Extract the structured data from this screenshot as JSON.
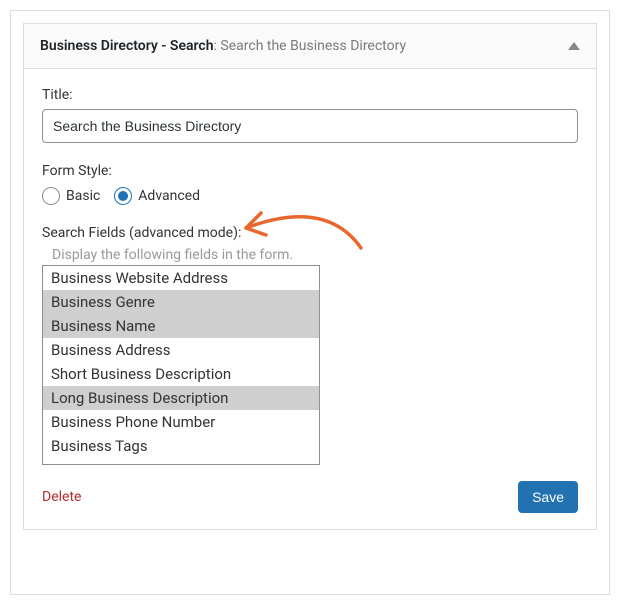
{
  "header": {
    "title_prefix": "Business Directory - Search",
    "title_suffix": ": Search the Business Directory"
  },
  "fields": {
    "title_label": "Title:",
    "title_value": "Search the Business Directory",
    "form_style_label": "Form Style:",
    "radio_basic": "Basic",
    "radio_advanced": "Advanced",
    "search_fields_label": "Search Fields (advanced mode):",
    "search_fields_helper": "Display the following fields in the form.",
    "options": [
      {
        "label": "Business Website Address",
        "selected": false
      },
      {
        "label": "Business Genre",
        "selected": true
      },
      {
        "label": "Business Name",
        "selected": true
      },
      {
        "label": "Business Address",
        "selected": false
      },
      {
        "label": "Short Business Description",
        "selected": false
      },
      {
        "label": "Long Business Description",
        "selected": true
      },
      {
        "label": "Business Phone Number",
        "selected": false
      },
      {
        "label": "Business Tags",
        "selected": false
      }
    ]
  },
  "footer": {
    "delete_label": "Delete",
    "save_label": "Save"
  },
  "colors": {
    "accent": "#2271b1",
    "danger": "#b32d2e",
    "annotation": "#e8672f"
  }
}
